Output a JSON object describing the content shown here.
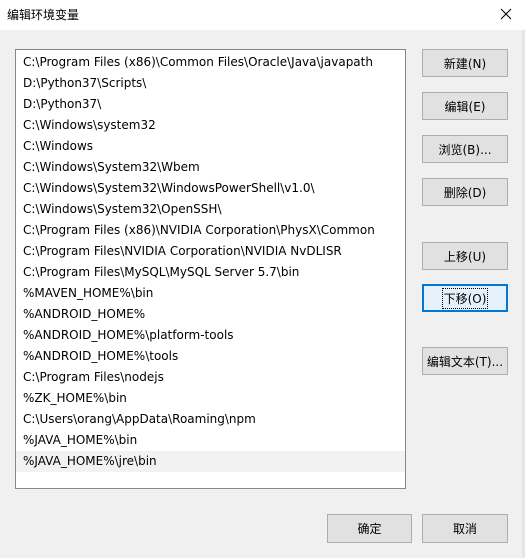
{
  "window": {
    "title": "编辑环境变量"
  },
  "list": {
    "items": [
      "C:\\Program Files (x86)\\Common Files\\Oracle\\Java\\javapath",
      "D:\\Python37\\Scripts\\",
      "D:\\Python37\\",
      "C:\\Windows\\system32",
      "C:\\Windows",
      "C:\\Windows\\System32\\Wbem",
      "C:\\Windows\\System32\\WindowsPowerShell\\v1.0\\",
      "C:\\Windows\\System32\\OpenSSH\\",
      "C:\\Program Files (x86)\\NVIDIA Corporation\\PhysX\\Common",
      "C:\\Program Files\\NVIDIA Corporation\\NVIDIA NvDLISR",
      "C:\\Program Files\\MySQL\\MySQL Server 5.7\\bin",
      "%MAVEN_HOME%\\bin",
      "%ANDROID_HOME%",
      "%ANDROID_HOME%\\platform-tools",
      "%ANDROID_HOME%\\tools",
      "C:\\Program Files\\nodejs",
      "%ZK_HOME%\\bin",
      "C:\\Users\\orang\\AppData\\Roaming\\npm",
      "%JAVA_HOME%\\bin",
      "%JAVA_HOME%\\jre\\bin"
    ]
  },
  "buttons": {
    "new": "新建(N)",
    "edit": "编辑(E)",
    "browse": "浏览(B)...",
    "delete": "删除(D)",
    "move_up": "上移(U)",
    "move_down": "下移(O)",
    "edit_text": "编辑文本(T)...",
    "ok": "确定",
    "cancel": "取消"
  },
  "icons": {
    "close": "close-icon"
  }
}
